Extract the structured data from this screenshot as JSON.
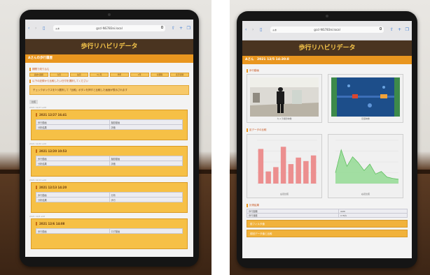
{
  "left_screen": {
    "url": "gccl-NG783ni.local",
    "url_prefix": "ぁあ",
    "title": "歩行リハビリデータ",
    "heading": "Aさんの歩行履歴",
    "section_label_1": "期間で絞り込む",
    "filter_buttons": [
      "過去1週間",
      "今月",
      "先月",
      "3ヶ月",
      "半年",
      "1年",
      "全期間",
      "表示切替"
    ],
    "section_label_2": "以下の記録から比較したい日付を選択してください",
    "notice_text": "チェックボックスを3つ選択して「比較」ボタンを押すと比較した画面が表示されます",
    "compare_tag": "比較",
    "records": [
      {
        "caption": "2021 12/27 edit",
        "date": "2021 12/27 16:41",
        "cells": [
          "歩行動画",
          "撮影動画",
          "分析結果",
          "評価"
        ]
      },
      {
        "caption": "2021 12/20 edit",
        "date": "2021 12/20 10:53",
        "cells": [
          "歩行動画",
          "撮影動画",
          "分析結果",
          "評価"
        ]
      },
      {
        "caption": "2021 12/13 edit",
        "date": "2021 12/13 14:20",
        "cells": [
          "歩行動画",
          "分析",
          "分析結果",
          "歩行"
        ]
      },
      {
        "caption": "2021 12/6 edit",
        "date": "2021 12/6 14:08",
        "cells": [
          "歩行動画",
          "ログ動画"
        ]
      }
    ]
  },
  "right_screen": {
    "url": "gccl-NG783ni.local",
    "url_prefix": "ぁあ",
    "title": "歩行リハビリデータ",
    "heading": "Aさん　2021 12/5 14:30:8",
    "section_label_1": "歩行動画",
    "photos": [
      {
        "label": "カメラ撮影映像"
      },
      {
        "label": "足底映像"
      }
    ],
    "section_label_2": "足データの比較",
    "bar_chart": {
      "type": "bar",
      "categories": [
        "1",
        "2",
        "3",
        "4",
        "5",
        "6",
        "7",
        "8"
      ],
      "values": [
        80,
        28,
        38,
        85,
        45,
        60,
        52,
        65
      ],
      "ylim": [
        0,
        100
      ],
      "color": "#ec8f8f",
      "caption": "左足比較"
    },
    "area_chart": {
      "type": "area",
      "x": [
        0,
        1,
        2,
        3,
        4,
        5,
        6,
        7,
        8,
        9,
        10,
        11
      ],
      "values": [
        25,
        78,
        40,
        62,
        48,
        30,
        45,
        22,
        28,
        15,
        12,
        10
      ],
      "ylim": [
        0,
        100
      ],
      "color": "#8fd98f",
      "caption": "右足比較"
    },
    "section_label_3": "計測結果",
    "results": [
      [
        "歩行距離",
        "xxm"
      ],
      [
        "歩行速度",
        "x m/s"
      ]
    ],
    "buttons": [
      "前フィルタ値",
      "前回データ値と比較"
    ]
  },
  "colors": {
    "title_bg": "#4a3420",
    "title_text": "#f7c64a",
    "heading_bg": "#e9961f",
    "card_bg": "#f6c046"
  }
}
